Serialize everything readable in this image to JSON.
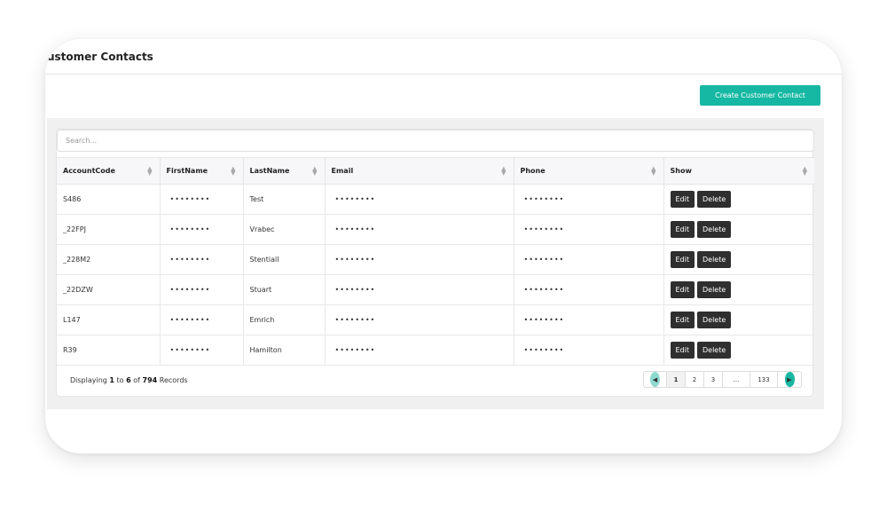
{
  "header": {
    "title": "ustomer Contacts"
  },
  "toolbar": {
    "create_label": "Create Customer Contact"
  },
  "search": {
    "placeholder": "Search..."
  },
  "table": {
    "columns": [
      "AccountCode",
      "FirstName",
      "LastName",
      "Email",
      "Phone",
      "Show"
    ],
    "rows": [
      {
        "account": "S486",
        "first": "••••••••",
        "last": "Test",
        "email": "••••••••",
        "phone": "••••••••"
      },
      {
        "account": "_22FPJ",
        "first": "••••••••",
        "last": "Vrabec",
        "email": "••••••••",
        "phone": "••••••••"
      },
      {
        "account": "_228M2",
        "first": "••••••••",
        "last": "Stentiall",
        "email": "••••••••",
        "phone": "••••••••"
      },
      {
        "account": "_22DZW",
        "first": "••••••••",
        "last": "Stuart",
        "email": "••••••••",
        "phone": "••••••••"
      },
      {
        "account": "L147",
        "first": "••••••••",
        "last": "Emrich",
        "email": "••••••••",
        "phone": "••••••••"
      },
      {
        "account": "R39",
        "first": "••••••••",
        "last": "Hamilton",
        "email": "••••••••",
        "phone": "••••••••"
      }
    ],
    "edit_label": "Edit",
    "delete_label": "Delete"
  },
  "footer": {
    "prefix": "Displaying",
    "from": "1",
    "to_word": "to",
    "to": "6",
    "of_word": "of",
    "total": "794",
    "suffix": "Records"
  },
  "pagination": {
    "pages": [
      "1",
      "2",
      "3",
      "...",
      "133"
    ]
  },
  "colors": {
    "accent": "#17b8a3",
    "dark_button": "#2f2f2f"
  }
}
